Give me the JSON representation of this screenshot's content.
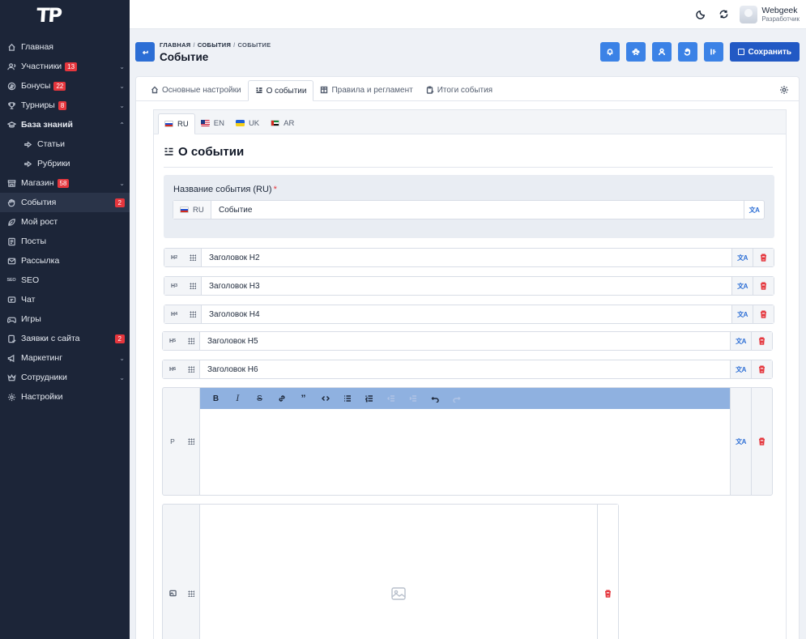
{
  "app": {
    "logo": "TP"
  },
  "sidebar": {
    "items": [
      {
        "label": "Главная",
        "icon": "home-icon"
      },
      {
        "label": "Участники",
        "icon": "users-icon",
        "badge": "13",
        "chevron": "down"
      },
      {
        "label": "Бонусы",
        "icon": "coin-icon",
        "badge": "22",
        "chevron": "down"
      },
      {
        "label": "Турниры",
        "icon": "trophy-icon",
        "badge": "8",
        "chevron": "down"
      },
      {
        "label": "База знаний",
        "icon": "graduation-cap-icon",
        "chevron": "up",
        "open": true
      },
      {
        "label": "Статьи",
        "icon": "arrow-right-icon",
        "sub": true
      },
      {
        "label": "Рубрики",
        "icon": "arrow-right-icon",
        "sub": true
      },
      {
        "label": "Магазин",
        "icon": "shop-icon",
        "badge": "58",
        "chevron": "down"
      },
      {
        "label": "События",
        "icon": "hand-icon",
        "badge_right": "2",
        "active": true
      },
      {
        "label": "Мой рост",
        "icon": "growth-icon"
      },
      {
        "label": "Посты",
        "icon": "posts-icon"
      },
      {
        "label": "Рассылка",
        "icon": "mail-icon"
      },
      {
        "label": "SEO",
        "icon": "seo-icon"
      },
      {
        "label": "Чат",
        "icon": "chat-icon"
      },
      {
        "label": "Игры",
        "icon": "gamepad-icon"
      },
      {
        "label": "Заявки с сайта",
        "icon": "requests-icon",
        "badge_right": "2"
      },
      {
        "label": "Маркетинг",
        "icon": "megaphone-icon",
        "chevron": "down"
      },
      {
        "label": "Сотрудники",
        "icon": "crown-icon",
        "chevron": "down"
      },
      {
        "label": "Настройки",
        "icon": "gear-icon"
      }
    ]
  },
  "topbar": {
    "user_name": "Webgeek",
    "user_role": "Разработчик"
  },
  "header": {
    "breadcrumbs": [
      "ГЛАВНАЯ",
      "СОБЫТИЯ",
      "СОБЫТИЕ"
    ],
    "title": "Событие",
    "save_label": "Сохранить"
  },
  "tabs": [
    {
      "label": "Основные настройки",
      "icon": "home-icon"
    },
    {
      "label": "О событии",
      "icon": "list-icon",
      "active": true
    },
    {
      "label": "Правила и регламент",
      "icon": "book-icon"
    },
    {
      "label": "Итоги события",
      "icon": "clipboard-icon"
    }
  ],
  "languages": [
    {
      "code": "RU",
      "flag": "ru",
      "active": true
    },
    {
      "code": "EN",
      "flag": "en"
    },
    {
      "code": "UK",
      "flag": "uk"
    },
    {
      "code": "AR",
      "flag": "ar"
    }
  ],
  "section": {
    "title": "О событии",
    "name_label": "Название события (RU)",
    "name_required": "*",
    "name_lang": "RU",
    "name_value": "Событие"
  },
  "blocks": [
    {
      "tag": "H2",
      "value": "Заголовок H2"
    },
    {
      "tag": "H3",
      "value": "Заголовок H3"
    },
    {
      "tag": "H4",
      "value": "Заголовок H4"
    },
    {
      "tag": "H5",
      "value": "Заголовок H5"
    },
    {
      "tag": "H6",
      "value": "Заголовок H6"
    }
  ],
  "paragraph": {
    "tag": "P"
  },
  "colors": {
    "sidebar": "#1c2538",
    "primary": "#2c6ed5",
    "danger": "#e5363d",
    "toolbar": "#8fb1e0"
  }
}
